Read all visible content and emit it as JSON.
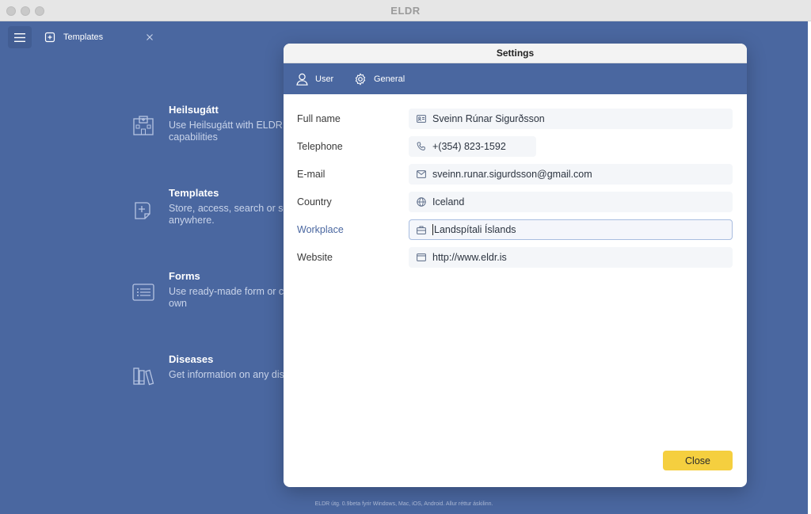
{
  "window": {
    "title": "ELDR"
  },
  "toolbar": {
    "tab": {
      "label": "Templates",
      "icon": "document-plus-icon"
    }
  },
  "home": {
    "items": [
      {
        "title": "Heilsugátt",
        "description": "Use Heilsugátt with ELDR\ncapabilities",
        "icon": "hospital-icon"
      },
      {
        "title": "Templates",
        "description": "Store, access, search or s\nanywhere.",
        "icon": "document-plus-icon"
      },
      {
        "title": "Forms",
        "description": "Use ready-made form or c\nown",
        "icon": "form-list-icon"
      },
      {
        "title": "Diseases",
        "description": "Get information on any dis",
        "icon": "books-icon"
      }
    ],
    "footer": "ELDR útg. 0.9beta fyrir Windows, Mac, iOS, Android. Allur réttur áskilinn."
  },
  "settings": {
    "title": "Settings",
    "tabs": [
      {
        "label": "User",
        "icon": "user-icon"
      },
      {
        "label": "General",
        "icon": "gear-icon"
      }
    ],
    "fields": [
      {
        "label": "Full name",
        "value": "Sveinn Rúnar Sigurðsson",
        "icon": "id-card-icon"
      },
      {
        "label": "Telephone",
        "value": "+(354) 823-1592",
        "icon": "phone-icon"
      },
      {
        "label": "E-mail",
        "value": "sveinn.runar.sigurdsson@gmail.com",
        "icon": "mail-icon"
      },
      {
        "label": "Country",
        "value": "Iceland",
        "icon": "globe-icon"
      },
      {
        "label": "Workplace",
        "value": "Landspítali Íslands",
        "icon": "briefcase-icon"
      },
      {
        "label": "Website",
        "value": "http://www.eldr.is",
        "icon": "browser-window-icon"
      }
    ],
    "close_label": "Close"
  },
  "colors": {
    "app_bg": "#4a67a0",
    "close_button": "#f5cf3f",
    "active_label": "#4a67a0"
  }
}
